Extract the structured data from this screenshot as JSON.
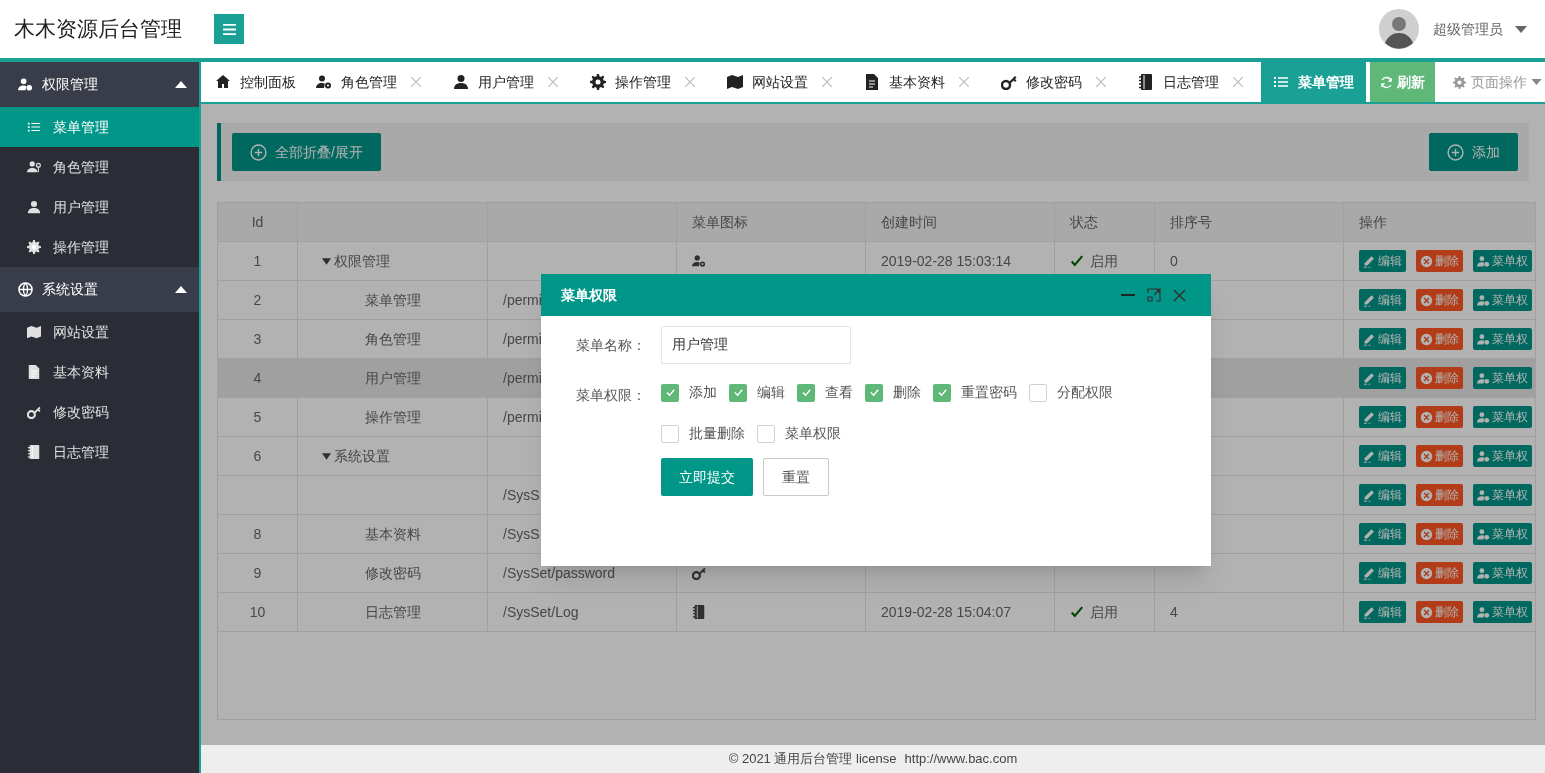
{
  "header": {
    "title": "木木资源后台管理",
    "user": "超级管理员"
  },
  "sidebar": {
    "groups": [
      {
        "label": "权限管理",
        "expanded": true,
        "children": [
          {
            "label": "菜单管理",
            "selected": true
          },
          {
            "label": "角色管理",
            "selected": false
          },
          {
            "label": "用户管理",
            "selected": false
          },
          {
            "label": "操作管理",
            "selected": false
          }
        ]
      },
      {
        "label": "系统设置",
        "expanded": true,
        "children": [
          {
            "label": "网站设置",
            "selected": false
          },
          {
            "label": "基本资料",
            "selected": false
          },
          {
            "label": "修改密码",
            "selected": false
          },
          {
            "label": "日志管理",
            "selected": false
          }
        ]
      }
    ]
  },
  "tabs": [
    {
      "label": "控制面板",
      "selected": false,
      "closable": false
    },
    {
      "label": "角色管理",
      "selected": false,
      "closable": true
    },
    {
      "label": "用户管理",
      "selected": false,
      "closable": true
    },
    {
      "label": "操作管理",
      "selected": false,
      "closable": true
    },
    {
      "label": "网站设置",
      "selected": false,
      "closable": true
    },
    {
      "label": "基本资料",
      "selected": false,
      "closable": true
    },
    {
      "label": "修改密码",
      "selected": false,
      "closable": true
    },
    {
      "label": "日志管理",
      "selected": false,
      "closable": true
    },
    {
      "label": "菜单管理",
      "selected": true,
      "closable": false
    }
  ],
  "tab_tools": {
    "refresh": "刷新",
    "page_actions": "页面操作"
  },
  "toolbar": {
    "collapse_button": "全部折叠/展开",
    "add_button": "添加"
  },
  "table": {
    "columns": [
      "Id",
      null,
      null,
      "菜单图标",
      "创建时间",
      "状态",
      "排序号",
      "操作"
    ],
    "rows": [
      {
        "kind": "group",
        "expanded": true,
        "selected": false,
        "id": "1",
        "name": "权限管理",
        "created": "2019-02-28 15:03:14",
        "status": "启用",
        "sort": "0",
        "actions": [
          "编辑",
          "删除",
          "菜单权"
        ]
      },
      {
        "kind": "item",
        "selected": false,
        "id": "2",
        "name": "菜单管理",
        "path": "/permi",
        "actions": [
          "编辑",
          "删除",
          "菜单权"
        ]
      },
      {
        "kind": "item",
        "selected": false,
        "id": "3",
        "name": "角色管理",
        "path": "/permi",
        "actions": [
          "编辑",
          "删除",
          "菜单权"
        ]
      },
      {
        "kind": "item",
        "selected": true,
        "id": "4",
        "name": "用户管理",
        "path": "/permi",
        "actions": [
          "编辑",
          "删除",
          "菜单权"
        ]
      },
      {
        "kind": "item",
        "selected": false,
        "id": "5",
        "name": "操作管理",
        "path": "/permi",
        "actions": [
          "编辑",
          "删除",
          "菜单权"
        ]
      },
      {
        "kind": "group",
        "expanded": true,
        "selected": false,
        "id": "6",
        "name": "系统设置",
        "actions": [
          "编辑",
          "删除",
          "菜单权"
        ]
      },
      {
        "kind": "item",
        "selected": false,
        "path": "/SysS",
        "actions": [
          "编辑",
          "删除",
          "菜单权"
        ]
      },
      {
        "kind": "item",
        "selected": false,
        "id": "8",
        "name": "基本资料",
        "path": "/SysS",
        "actions": [
          "编辑",
          "删除",
          "菜单权"
        ]
      },
      {
        "kind": "item",
        "selected": false,
        "id": "9",
        "name": "修改密码",
        "path": "/SysSet/password",
        "actions": [
          "编辑",
          "删除",
          "菜单权"
        ]
      },
      {
        "kind": "item",
        "selected": false,
        "id": "10",
        "name": "日志管理",
        "path": "/SysSet/Log",
        "created": "2019-02-28 15:04:07",
        "status": "启用",
        "sort": "4",
        "actions": [
          "编辑",
          "删除",
          "菜单权"
        ]
      }
    ]
  },
  "dialog": {
    "title": "菜单权限",
    "name_label": "菜单名称：",
    "name_value": "用户管理",
    "perm_label": "菜单权限：",
    "permissions": [
      {
        "label": "添加",
        "checked": true
      },
      {
        "label": "编辑",
        "checked": true
      },
      {
        "label": "查看",
        "checked": true
      },
      {
        "label": "删除",
        "checked": true
      },
      {
        "label": "重置密码",
        "checked": true
      },
      {
        "label": "分配权限",
        "checked": false
      },
      {
        "label": "批量删除",
        "checked": false
      },
      {
        "label": "菜单权限",
        "checked": false
      }
    ],
    "submit": "立即提交",
    "reset": "重置"
  },
  "footer": {
    "text": "© 2021 通用后台管理 license",
    "link": "http://www.bac.com"
  }
}
